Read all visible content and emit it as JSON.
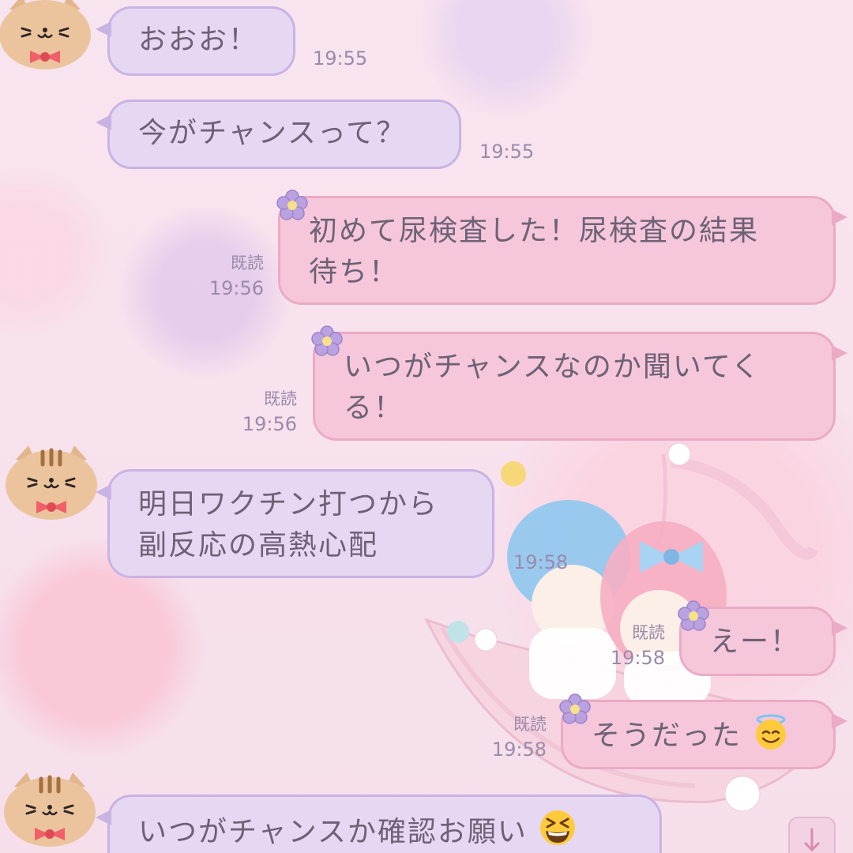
{
  "chat": {
    "read_label": "既読",
    "messages": [
      {
        "side": "received",
        "text": "おおお！",
        "time": "19:55"
      },
      {
        "side": "received",
        "text": "今がチャンスって？",
        "time": "19:55"
      },
      {
        "side": "sent",
        "line1": "初めて尿検査した！尿検査の結果",
        "line2": "待ち！",
        "time": "19:56"
      },
      {
        "side": "sent",
        "line1": "いつがチャンスなのか聞いてく",
        "line2": "る！",
        "time": "19:56"
      },
      {
        "side": "received",
        "line1": "明日ワクチン打つから",
        "line2": "副反応の高熱心配",
        "time": "19:58"
      },
      {
        "side": "sent",
        "text": "えー！",
        "time": "19:58"
      },
      {
        "side": "sent",
        "text": "そうだった",
        "emoji": "smiling-face-with-halo",
        "time": "19:58"
      },
      {
        "side": "received",
        "text": "いつがチャンスか確認お願い",
        "emoji": "grinning-squinting-face"
      }
    ]
  },
  "colors": {
    "received_bubble": "#e6d8f3",
    "sent_bubble": "#f6c6da",
    "text": "#6d6275",
    "meta": "#9b8aab"
  },
  "icons": {
    "avatar": "cat-avatar-icon",
    "sent_decoration": "flower-icon",
    "scroll": "scroll-down-icon"
  }
}
